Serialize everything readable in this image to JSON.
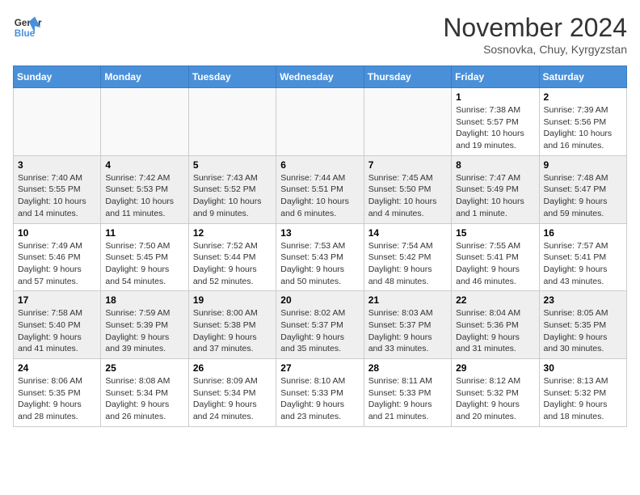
{
  "header": {
    "logo_line1": "General",
    "logo_line2": "Blue",
    "month": "November 2024",
    "location": "Sosnovka, Chuy, Kyrgyzstan"
  },
  "weekdays": [
    "Sunday",
    "Monday",
    "Tuesday",
    "Wednesday",
    "Thursday",
    "Friday",
    "Saturday"
  ],
  "weeks": [
    [
      {
        "day": "",
        "info": ""
      },
      {
        "day": "",
        "info": ""
      },
      {
        "day": "",
        "info": ""
      },
      {
        "day": "",
        "info": ""
      },
      {
        "day": "",
        "info": ""
      },
      {
        "day": "1",
        "info": "Sunrise: 7:38 AM\nSunset: 5:57 PM\nDaylight: 10 hours and 19 minutes."
      },
      {
        "day": "2",
        "info": "Sunrise: 7:39 AM\nSunset: 5:56 PM\nDaylight: 10 hours and 16 minutes."
      }
    ],
    [
      {
        "day": "3",
        "info": "Sunrise: 7:40 AM\nSunset: 5:55 PM\nDaylight: 10 hours and 14 minutes."
      },
      {
        "day": "4",
        "info": "Sunrise: 7:42 AM\nSunset: 5:53 PM\nDaylight: 10 hours and 11 minutes."
      },
      {
        "day": "5",
        "info": "Sunrise: 7:43 AM\nSunset: 5:52 PM\nDaylight: 10 hours and 9 minutes."
      },
      {
        "day": "6",
        "info": "Sunrise: 7:44 AM\nSunset: 5:51 PM\nDaylight: 10 hours and 6 minutes."
      },
      {
        "day": "7",
        "info": "Sunrise: 7:45 AM\nSunset: 5:50 PM\nDaylight: 10 hours and 4 minutes."
      },
      {
        "day": "8",
        "info": "Sunrise: 7:47 AM\nSunset: 5:49 PM\nDaylight: 10 hours and 1 minute."
      },
      {
        "day": "9",
        "info": "Sunrise: 7:48 AM\nSunset: 5:47 PM\nDaylight: 9 hours and 59 minutes."
      }
    ],
    [
      {
        "day": "10",
        "info": "Sunrise: 7:49 AM\nSunset: 5:46 PM\nDaylight: 9 hours and 57 minutes."
      },
      {
        "day": "11",
        "info": "Sunrise: 7:50 AM\nSunset: 5:45 PM\nDaylight: 9 hours and 54 minutes."
      },
      {
        "day": "12",
        "info": "Sunrise: 7:52 AM\nSunset: 5:44 PM\nDaylight: 9 hours and 52 minutes."
      },
      {
        "day": "13",
        "info": "Sunrise: 7:53 AM\nSunset: 5:43 PM\nDaylight: 9 hours and 50 minutes."
      },
      {
        "day": "14",
        "info": "Sunrise: 7:54 AM\nSunset: 5:42 PM\nDaylight: 9 hours and 48 minutes."
      },
      {
        "day": "15",
        "info": "Sunrise: 7:55 AM\nSunset: 5:41 PM\nDaylight: 9 hours and 46 minutes."
      },
      {
        "day": "16",
        "info": "Sunrise: 7:57 AM\nSunset: 5:41 PM\nDaylight: 9 hours and 43 minutes."
      }
    ],
    [
      {
        "day": "17",
        "info": "Sunrise: 7:58 AM\nSunset: 5:40 PM\nDaylight: 9 hours and 41 minutes."
      },
      {
        "day": "18",
        "info": "Sunrise: 7:59 AM\nSunset: 5:39 PM\nDaylight: 9 hours and 39 minutes."
      },
      {
        "day": "19",
        "info": "Sunrise: 8:00 AM\nSunset: 5:38 PM\nDaylight: 9 hours and 37 minutes."
      },
      {
        "day": "20",
        "info": "Sunrise: 8:02 AM\nSunset: 5:37 PM\nDaylight: 9 hours and 35 minutes."
      },
      {
        "day": "21",
        "info": "Sunrise: 8:03 AM\nSunset: 5:37 PM\nDaylight: 9 hours and 33 minutes."
      },
      {
        "day": "22",
        "info": "Sunrise: 8:04 AM\nSunset: 5:36 PM\nDaylight: 9 hours and 31 minutes."
      },
      {
        "day": "23",
        "info": "Sunrise: 8:05 AM\nSunset: 5:35 PM\nDaylight: 9 hours and 30 minutes."
      }
    ],
    [
      {
        "day": "24",
        "info": "Sunrise: 8:06 AM\nSunset: 5:35 PM\nDaylight: 9 hours and 28 minutes."
      },
      {
        "day": "25",
        "info": "Sunrise: 8:08 AM\nSunset: 5:34 PM\nDaylight: 9 hours and 26 minutes."
      },
      {
        "day": "26",
        "info": "Sunrise: 8:09 AM\nSunset: 5:34 PM\nDaylight: 9 hours and 24 minutes."
      },
      {
        "day": "27",
        "info": "Sunrise: 8:10 AM\nSunset: 5:33 PM\nDaylight: 9 hours and 23 minutes."
      },
      {
        "day": "28",
        "info": "Sunrise: 8:11 AM\nSunset: 5:33 PM\nDaylight: 9 hours and 21 minutes."
      },
      {
        "day": "29",
        "info": "Sunrise: 8:12 AM\nSunset: 5:32 PM\nDaylight: 9 hours and 20 minutes."
      },
      {
        "day": "30",
        "info": "Sunrise: 8:13 AM\nSunset: 5:32 PM\nDaylight: 9 hours and 18 minutes."
      }
    ]
  ]
}
